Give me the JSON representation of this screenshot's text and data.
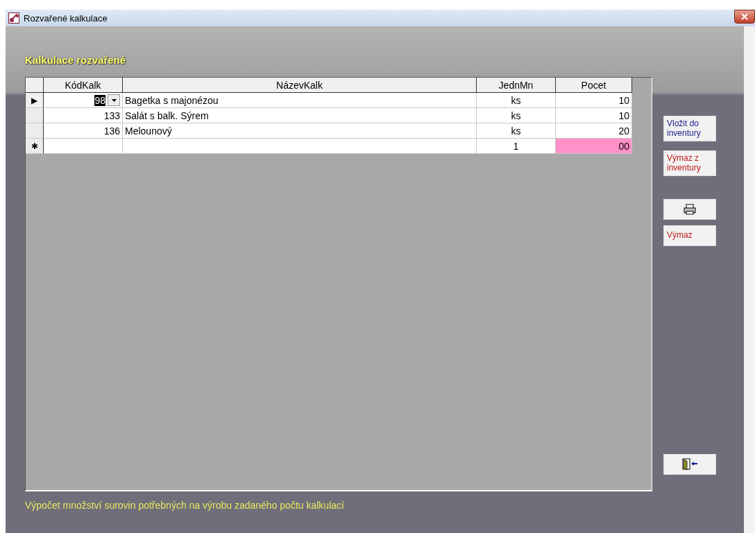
{
  "window": {
    "title": "Rozvařené kalkulace"
  },
  "heading": "Kalkulace rozvařené",
  "table": {
    "columns": [
      "KódKalk",
      "NázevKalk",
      "JednMn",
      "Pocet"
    ],
    "rows": [
      {
        "selector": "▶",
        "selected": true,
        "kod": "98",
        "kod_dropdown": true,
        "nazev": "Bagetka s majonézou",
        "jedn": "ks",
        "pocet": "10",
        "pocet_highlight": false
      },
      {
        "selected": false,
        "kod": "133",
        "kod_dropdown": false,
        "nazev": "Salát s balk. Sýrem",
        "jedn": "ks",
        "pocet": "10",
        "pocet_highlight": false
      },
      {
        "selected": false,
        "kod": "136",
        "kod_dropdown": false,
        "nazev": "Melounový",
        "jedn": "ks",
        "pocet": "20",
        "pocet_highlight": false
      },
      {
        "selector": "✱",
        "selected": false,
        "kod_dropdown": false,
        "jedn": "1",
        "pocet": "00",
        "pocet_highlight": true
      }
    ]
  },
  "buttons": [
    {
      "kind": "text",
      "label": "Vložit do inventury",
      "color": "#1a1a8a"
    },
    {
      "kind": "text",
      "label": "Výmaz z inventury",
      "color": "#c01818"
    },
    {
      "kind": "print"
    },
    {
      "kind": "text",
      "label": "Výmaz",
      "color": "#c01818"
    },
    {
      "kind": "exit"
    }
  ],
  "footer": "Výpočet množství surovin potřebných na výrobu zadaného počtu kalkulací"
}
